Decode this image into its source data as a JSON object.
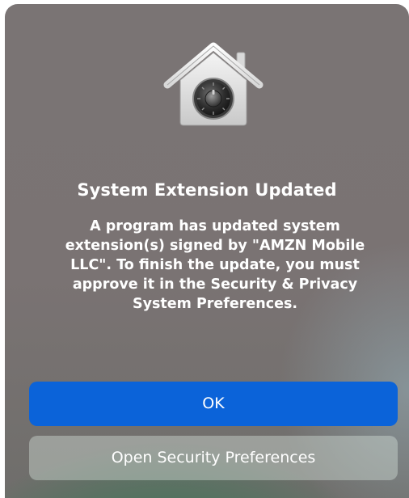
{
  "dialog": {
    "title": "System Extension Updated",
    "message": "A program has updated system extension(s) signed by \"AMZN Mobile LLC\". To finish the update, you must approve it in the Security & Privacy System Preferences.",
    "icon": "security-house-lock-icon"
  },
  "buttons": {
    "ok_label": "OK",
    "open_security_label": "Open Security Preferences"
  },
  "colors": {
    "primary_button": "#0b63d9",
    "text": "#ffffff"
  }
}
